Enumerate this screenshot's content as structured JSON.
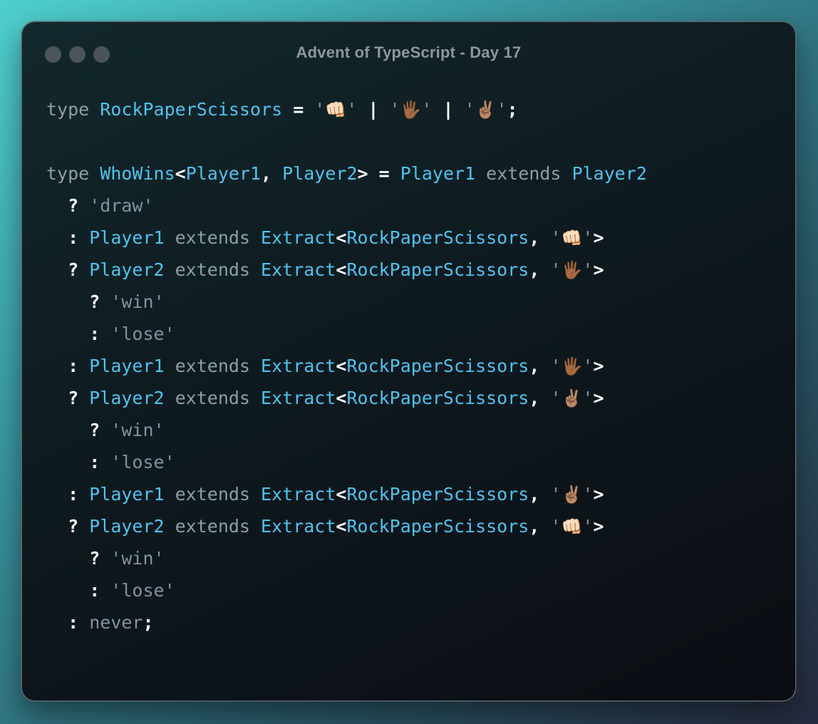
{
  "window": {
    "title": "Advent of TypeScript - Day 17",
    "traffic_lights": [
      "close-button",
      "minimize-button",
      "maximize-button"
    ]
  },
  "colors": {
    "keyword": "#8aa0a6",
    "type": "#4fc3f0",
    "operator": "#ffffff",
    "string": "#8292a1"
  },
  "code": {
    "lines": [
      [
        {
          "t": "kw",
          "v": "type "
        },
        {
          "t": "type",
          "v": "RockPaperScissors"
        },
        {
          "t": "op",
          "v": " = "
        },
        {
          "t": "str",
          "v": "'"
        },
        {
          "t": "emoji",
          "v": "👊🏻"
        },
        {
          "t": "str",
          "v": "'"
        },
        {
          "t": "op",
          "v": " | "
        },
        {
          "t": "str",
          "v": "'"
        },
        {
          "t": "emoji",
          "v": "🖐🏾"
        },
        {
          "t": "str",
          "v": "'"
        },
        {
          "t": "op",
          "v": " | "
        },
        {
          "t": "str",
          "v": "'"
        },
        {
          "t": "emoji",
          "v": "✌🏽"
        },
        {
          "t": "str",
          "v": "'"
        },
        {
          "t": "op",
          "v": ";"
        }
      ],
      [],
      [
        {
          "t": "kw",
          "v": "type "
        },
        {
          "t": "type",
          "v": "WhoWins"
        },
        {
          "t": "op",
          "v": "<"
        },
        {
          "t": "type",
          "v": "Player1"
        },
        {
          "t": "op",
          "v": ", "
        },
        {
          "t": "type",
          "v": "Player2"
        },
        {
          "t": "op",
          "v": "> = "
        },
        {
          "t": "type",
          "v": "Player1"
        },
        {
          "t": "kw",
          "v": " extends "
        },
        {
          "t": "type",
          "v": "Player2"
        }
      ],
      [
        {
          "t": "op",
          "v": "  ? "
        },
        {
          "t": "str",
          "v": "'draw'"
        }
      ],
      [
        {
          "t": "op",
          "v": "  : "
        },
        {
          "t": "type",
          "v": "Player1"
        },
        {
          "t": "kw",
          "v": " extends "
        },
        {
          "t": "type",
          "v": "Extract"
        },
        {
          "t": "op",
          "v": "<"
        },
        {
          "t": "type",
          "v": "RockPaperScissors"
        },
        {
          "t": "op",
          "v": ", "
        },
        {
          "t": "str",
          "v": "'"
        },
        {
          "t": "emoji",
          "v": "👊🏻"
        },
        {
          "t": "str",
          "v": "'"
        },
        {
          "t": "op",
          "v": ">"
        }
      ],
      [
        {
          "t": "op",
          "v": "  ? "
        },
        {
          "t": "type",
          "v": "Player2"
        },
        {
          "t": "kw",
          "v": " extends "
        },
        {
          "t": "type",
          "v": "Extract"
        },
        {
          "t": "op",
          "v": "<"
        },
        {
          "t": "type",
          "v": "RockPaperScissors"
        },
        {
          "t": "op",
          "v": ", "
        },
        {
          "t": "str",
          "v": "'"
        },
        {
          "t": "emoji",
          "v": "🖐🏾"
        },
        {
          "t": "str",
          "v": "'"
        },
        {
          "t": "op",
          "v": ">"
        }
      ],
      [
        {
          "t": "op",
          "v": "    ? "
        },
        {
          "t": "str",
          "v": "'win'"
        }
      ],
      [
        {
          "t": "op",
          "v": "    : "
        },
        {
          "t": "str",
          "v": "'lose'"
        }
      ],
      [
        {
          "t": "op",
          "v": "  : "
        },
        {
          "t": "type",
          "v": "Player1"
        },
        {
          "t": "kw",
          "v": " extends "
        },
        {
          "t": "type",
          "v": "Extract"
        },
        {
          "t": "op",
          "v": "<"
        },
        {
          "t": "type",
          "v": "RockPaperScissors"
        },
        {
          "t": "op",
          "v": ", "
        },
        {
          "t": "str",
          "v": "'"
        },
        {
          "t": "emoji",
          "v": "🖐🏾"
        },
        {
          "t": "str",
          "v": "'"
        },
        {
          "t": "op",
          "v": ">"
        }
      ],
      [
        {
          "t": "op",
          "v": "  ? "
        },
        {
          "t": "type",
          "v": "Player2"
        },
        {
          "t": "kw",
          "v": " extends "
        },
        {
          "t": "type",
          "v": "Extract"
        },
        {
          "t": "op",
          "v": "<"
        },
        {
          "t": "type",
          "v": "RockPaperScissors"
        },
        {
          "t": "op",
          "v": ", "
        },
        {
          "t": "str",
          "v": "'"
        },
        {
          "t": "emoji",
          "v": "✌🏽"
        },
        {
          "t": "str",
          "v": "'"
        },
        {
          "t": "op",
          "v": ">"
        }
      ],
      [
        {
          "t": "op",
          "v": "    ? "
        },
        {
          "t": "str",
          "v": "'win'"
        }
      ],
      [
        {
          "t": "op",
          "v": "    : "
        },
        {
          "t": "str",
          "v": "'lose'"
        }
      ],
      [
        {
          "t": "op",
          "v": "  : "
        },
        {
          "t": "type",
          "v": "Player1"
        },
        {
          "t": "kw",
          "v": " extends "
        },
        {
          "t": "type",
          "v": "Extract"
        },
        {
          "t": "op",
          "v": "<"
        },
        {
          "t": "type",
          "v": "RockPaperScissors"
        },
        {
          "t": "op",
          "v": ", "
        },
        {
          "t": "str",
          "v": "'"
        },
        {
          "t": "emoji",
          "v": "✌🏽"
        },
        {
          "t": "str",
          "v": "'"
        },
        {
          "t": "op",
          "v": ">"
        }
      ],
      [
        {
          "t": "op",
          "v": "  ? "
        },
        {
          "t": "type",
          "v": "Player2"
        },
        {
          "t": "kw",
          "v": " extends "
        },
        {
          "t": "type",
          "v": "Extract"
        },
        {
          "t": "op",
          "v": "<"
        },
        {
          "t": "type",
          "v": "RockPaperScissors"
        },
        {
          "t": "op",
          "v": ", "
        },
        {
          "t": "str",
          "v": "'"
        },
        {
          "t": "emoji",
          "v": "👊🏻"
        },
        {
          "t": "str",
          "v": "'"
        },
        {
          "t": "op",
          "v": ">"
        }
      ],
      [
        {
          "t": "op",
          "v": "    ? "
        },
        {
          "t": "str",
          "v": "'win'"
        }
      ],
      [
        {
          "t": "op",
          "v": "    : "
        },
        {
          "t": "str",
          "v": "'lose'"
        }
      ],
      [
        {
          "t": "op",
          "v": "  : "
        },
        {
          "t": "str",
          "v": "never"
        },
        {
          "t": "op",
          "v": ";"
        }
      ]
    ]
  }
}
